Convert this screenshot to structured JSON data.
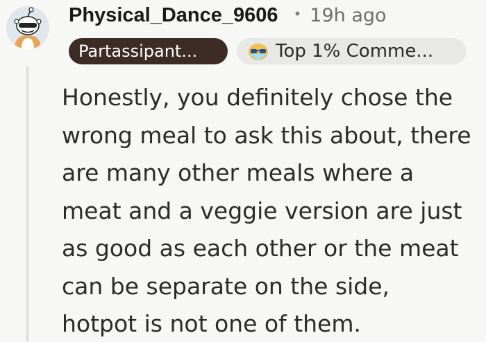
{
  "comment": {
    "username": "Physical_Dance_9606",
    "separator": "•",
    "timestamp": "19h ago",
    "flair": "Partassipant...",
    "achievement": {
      "label": "Top 1% Comme...",
      "icon": "sunglasses-badge-icon"
    },
    "avatar_icon": "snoo-avatar-icon",
    "body_lines": [
      "Honestly, you definitely chose the",
      "wrong meal to ask this about, there",
      "are many other meals where a",
      "meat and a veggie version are just",
      "as good as each other or the meat",
      "can be separate on the side,",
      "hotpot is not one of them."
    ]
  }
}
